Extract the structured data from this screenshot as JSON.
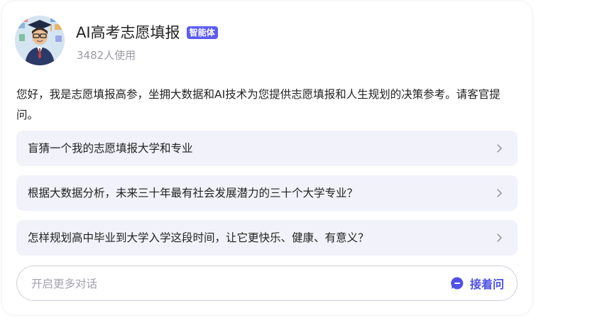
{
  "agent": {
    "name": "AI高考志愿填报",
    "badge": "智能体",
    "users": "3482人使用",
    "avatar_icon": "avatar-graduate-icon"
  },
  "intro": "您好，我是志愿填报高参，坐拥大数据和AI技术为您提供志愿填报和人生规划的决策参考。请客官提问。",
  "suggestions": [
    {
      "text": "盲猜一个我的志愿填报大学和专业"
    },
    {
      "text": "根据大数据分析，未来三十年最有社会发展潜力的三十个大学专业？"
    },
    {
      "text": "怎样规划高中毕业到大学入学这段时间，让它更快乐、健康、有意义？"
    }
  ],
  "input": {
    "placeholder": "开启更多对话",
    "value": ""
  },
  "ask_button": {
    "label": "接着问"
  },
  "colors": {
    "accent": "#4f51e6",
    "badge_bg": "#5b5cf0",
    "suggestion_bg": "#f1f2fa"
  }
}
